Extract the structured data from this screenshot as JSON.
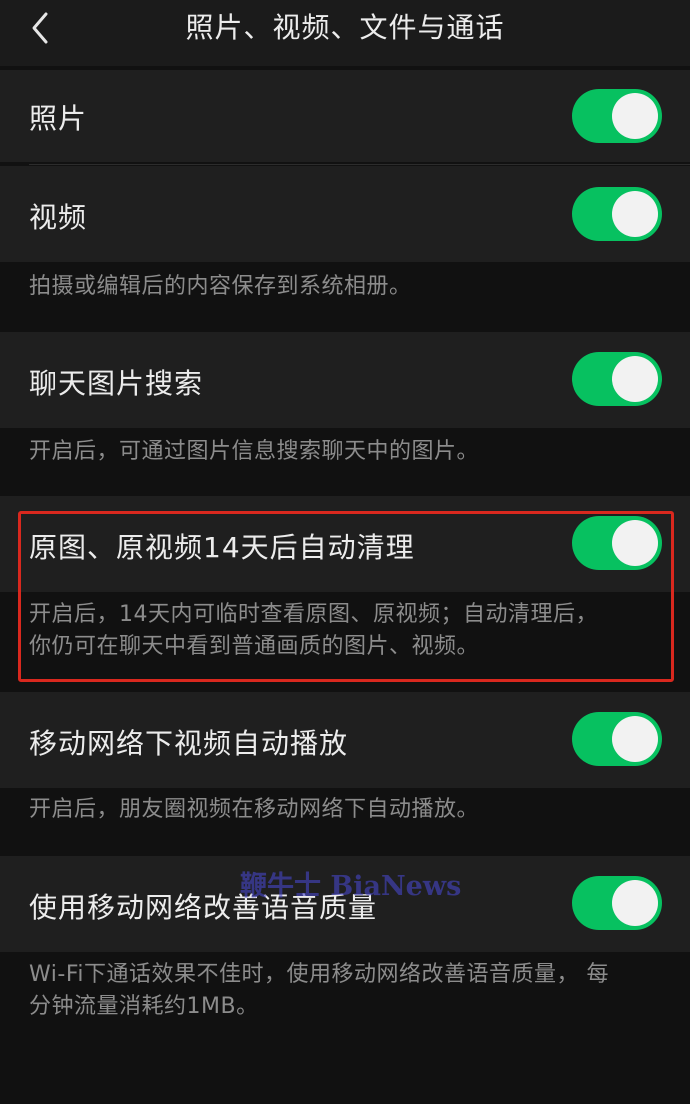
{
  "nav": {
    "title": "照片、视频、文件与通话",
    "back_icon": "chevron-left-icon"
  },
  "settings": [
    {
      "label": "照片",
      "enabled": true
    },
    {
      "label": "视频",
      "enabled": true,
      "note": "拍摄或编辑后的内容保存到系统相册。"
    },
    {
      "label": "聊天图片搜索",
      "enabled": true,
      "note": "开启后，可通过图片信息搜索聊天中的图片。"
    },
    {
      "label": "原图、原视频14天后自动清理",
      "enabled": true,
      "note_line1": "开启后，14天内可临时查看原图、原视频；自动清理后，",
      "note_line2": "你仍可在聊天中看到普通画质的图片、视频。"
    },
    {
      "label": "移动网络下视频自动播放",
      "enabled": true,
      "note": "开启后，朋友圈视频在移动网络下自动播放。"
    },
    {
      "label": "使用移动网络改善语音质量",
      "enabled": true,
      "note_line1": "Wi-Fi下通话效果不佳时，使用移动网络改善语音质量，  每",
      "note_line2": "分钟流量消耗约1MB。"
    }
  ],
  "watermark": "鞭牛士 BiaNews",
  "colors": {
    "background": "#111111",
    "row": "#1f1f1f",
    "toggle_on": "#07c160",
    "highlight_border": "#d9281e"
  }
}
